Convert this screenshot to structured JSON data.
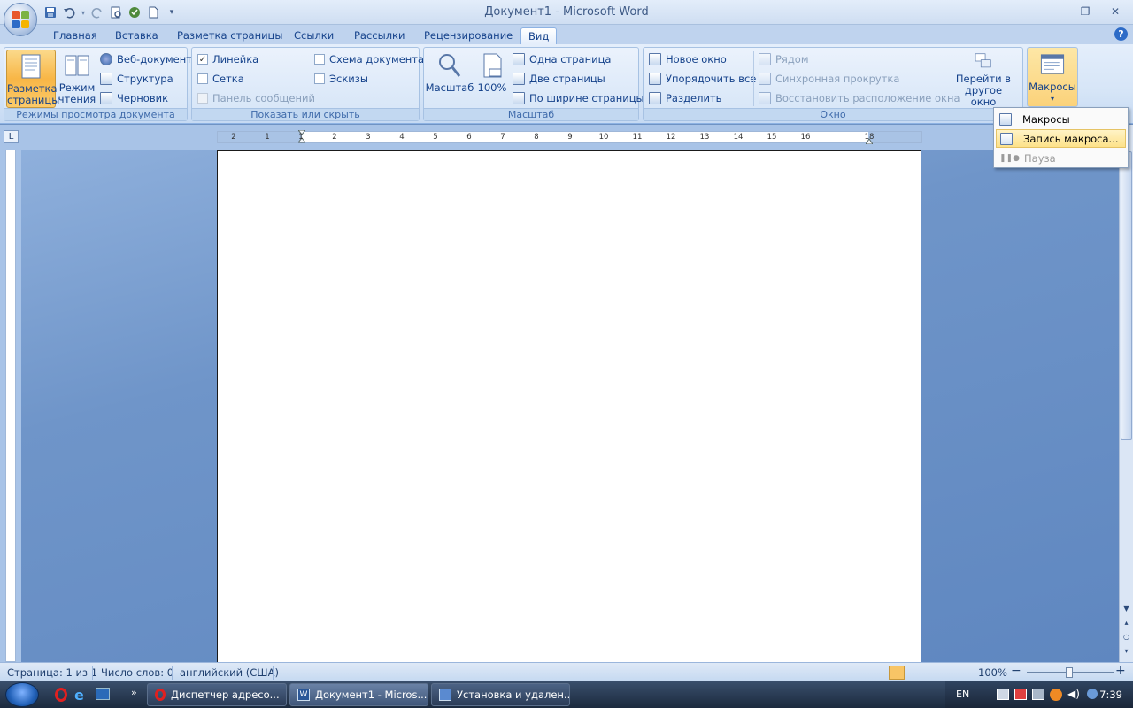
{
  "window": {
    "title": "Документ1 - Microsoft Word",
    "minimize": "‒",
    "restore": "❐",
    "close": "✕"
  },
  "tabs": [
    "Главная",
    "Вставка",
    "Разметка страницы",
    "Ссылки",
    "Рассылки",
    "Рецензирование",
    "Вид"
  ],
  "active_tab": "Вид",
  "help": "?",
  "ribbon": {
    "views": {
      "label": "Режимы просмотра документа",
      "print_layout": "Разметка страницы",
      "reading": "Режим чтения",
      "web": "Веб-документ",
      "outline": "Структура",
      "draft": "Черновик"
    },
    "show_hide": {
      "label": "Показать или скрыть",
      "ruler": "Линейка",
      "ruler_checked": true,
      "grid": "Сетка",
      "message_bar": "Панель сообщений",
      "doc_map": "Схема документа",
      "thumbnails": "Эскизы",
      "check": "✓"
    },
    "zoom": {
      "label": "Масштаб",
      "zoom": "Масштаб",
      "hundred": "100%",
      "one_page": "Одна страница",
      "two_pages": "Две страницы",
      "page_width": "По ширине страницы"
    },
    "window": {
      "label": "Окно",
      "new_window": "Новое окно",
      "arrange_all": "Упорядочить все",
      "split": "Разделить",
      "side_by_side": "Рядом",
      "sync_scroll": "Синхронная прокрутка",
      "reset_position": "Восстановить расположение окна",
      "switch_windows": "Перейти в другое окно",
      "switch_arrow": "▾"
    },
    "macros": {
      "label": "Макросы",
      "arrow": "▾"
    }
  },
  "macros_menu": {
    "items": [
      "Макросы",
      "Запись макроса...",
      "Пауза"
    ]
  },
  "ruler": {
    "toggle": "L",
    "numbers": [
      "2",
      "1",
      "1",
      "2",
      "3",
      "4",
      "5",
      "6",
      "7",
      "8",
      "9",
      "10",
      "11",
      "12",
      "13",
      "14",
      "15",
      "16",
      "18"
    ]
  },
  "status": {
    "page": "Страница: 1 из 1",
    "words": "Число слов: 0",
    "language": "английский (США)",
    "zoom": "100%",
    "zoom_minus": "−",
    "zoom_plus": "+"
  },
  "taskbar": {
    "buttons": [
      "Диспетчер адресо...",
      "Документ1 - Micros...",
      "Установка и удален..."
    ],
    "lang": "EN",
    "time": "7:39",
    "more": "»"
  }
}
